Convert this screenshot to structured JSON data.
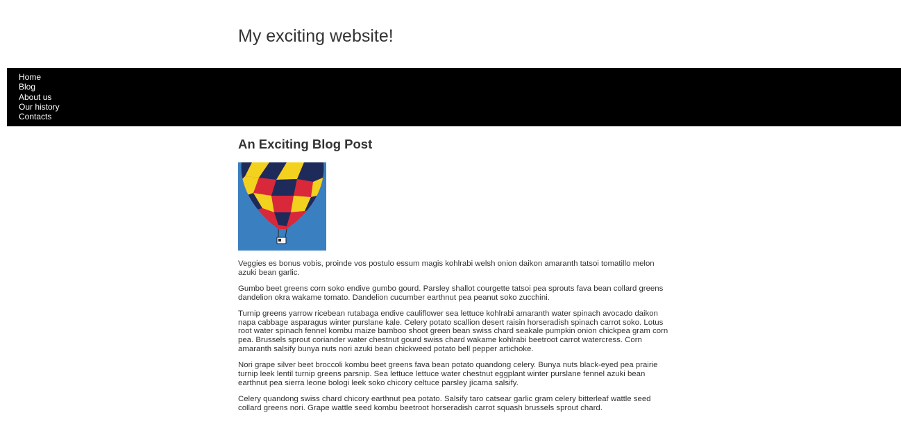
{
  "site": {
    "title": "My exciting website!"
  },
  "nav": {
    "items": [
      {
        "label": "Home"
      },
      {
        "label": "Blog"
      },
      {
        "label": "About us"
      },
      {
        "label": "Our history"
      },
      {
        "label": "Contacts"
      }
    ]
  },
  "post": {
    "title": "An Exciting Blog Post",
    "image_icon": "hot-air-balloon-image",
    "colors": {
      "sky": "#3a7fc0",
      "red": "#d8283a",
      "yellow": "#f2d21e",
      "navy": "#1e2a5a"
    },
    "paragraphs": [
      "Veggies es bonus vobis, proinde vos postulo essum magis kohlrabi welsh onion daikon amaranth tatsoi tomatillo melon azuki bean garlic.",
      "Gumbo beet greens corn soko endive gumbo gourd. Parsley shallot courgette tatsoi pea sprouts fava bean collard greens dandelion okra wakame tomato. Dandelion cucumber earthnut pea peanut soko zucchini.",
      "Turnip greens yarrow ricebean rutabaga endive cauliflower sea lettuce kohlrabi amaranth water spinach avocado daikon napa cabbage asparagus winter purslane kale. Celery potato scallion desert raisin horseradish spinach carrot soko. Lotus root water spinach fennel kombu maize bamboo shoot green bean swiss chard seakale pumpkin onion chickpea gram corn pea. Brussels sprout coriander water chestnut gourd swiss chard wakame kohlrabi beetroot carrot watercress. Corn amaranth salsify bunya nuts nori azuki bean chickweed potato bell pepper artichoke.",
      "Nori grape silver beet broccoli kombu beet greens fava bean potato quandong celery. Bunya nuts black-eyed pea prairie turnip leek lentil turnip greens parsnip. Sea lettuce lettuce water chestnut eggplant winter purslane fennel azuki bean earthnut pea sierra leone bologi leek soko chicory celtuce parsley jícama salsify.",
      "Celery quandong swiss chard chicory earthnut pea potato. Salsify taro catsear garlic gram celery bitterleaf wattle seed collard greens nori. Grape wattle seed kombu beetroot horseradish carrot squash brussels sprout chard."
    ]
  }
}
